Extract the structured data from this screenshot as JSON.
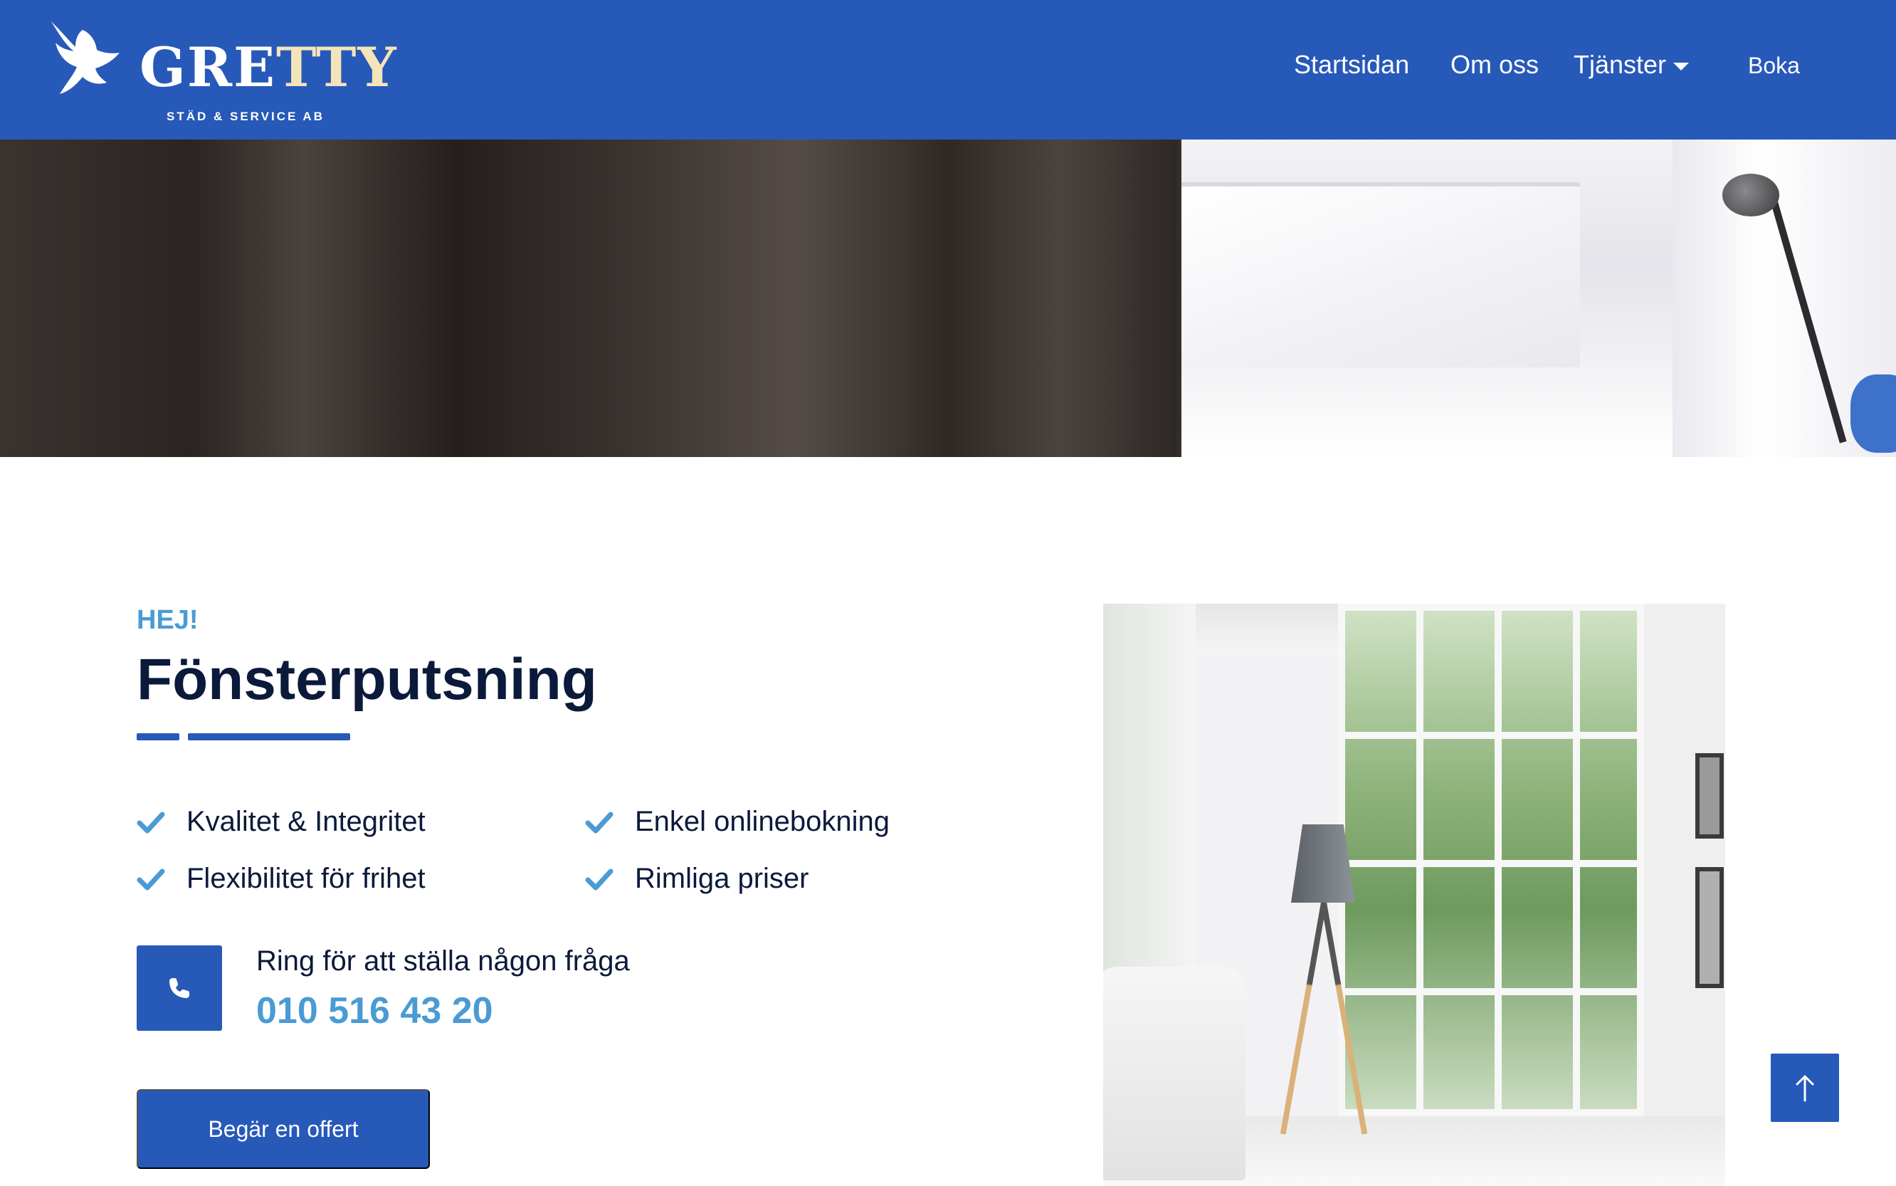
{
  "brand": {
    "name_white": "GRE",
    "name_gold": "TTY",
    "tagline": "STÄD & SERVICE AB",
    "dove_icon": "dove-icon"
  },
  "nav": {
    "items": [
      {
        "label": "Startsidan"
      },
      {
        "label": "Om oss"
      },
      {
        "label": "Tjänster"
      },
      {
        "label": "Boka"
      }
    ]
  },
  "intro": {
    "eyebrow": "HEJ!",
    "title": "Fönsterputsning"
  },
  "features": [
    {
      "label": "Kvalitet & Integritet"
    },
    {
      "label": "Enkel onlinebokning"
    },
    {
      "label": "Flexibilitet för frihet"
    },
    {
      "label": "Rimliga priser"
    }
  ],
  "contact": {
    "label": "Ring för att ställa någon fråga",
    "phone": "010 516 43 20",
    "icon": "phone-icon"
  },
  "cta": {
    "label": "Begär en offert"
  },
  "colors": {
    "primary": "#2759b9",
    "accent": "#4a9bd4",
    "heading": "#0b1a3a",
    "gold": "#f4e5b8"
  }
}
